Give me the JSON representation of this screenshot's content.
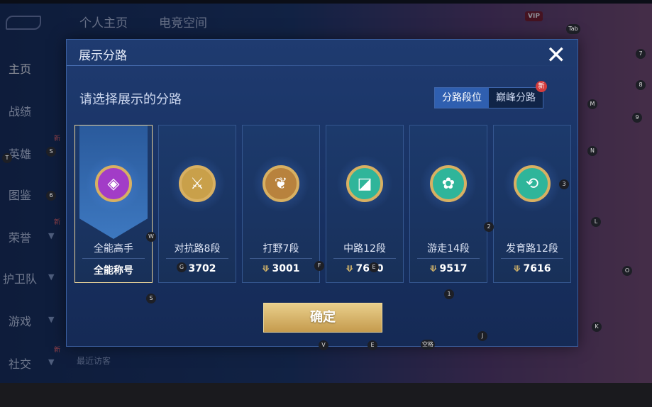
{
  "top_tabs": [
    "个人主页",
    "电竞空间"
  ],
  "left_nav": {
    "items": [
      {
        "label": "主页",
        "new": ""
      },
      {
        "label": "战绩",
        "new": ""
      },
      {
        "label": "英雄",
        "new": "新"
      },
      {
        "label": "图鉴",
        "new": ""
      },
      {
        "label": "荣誉",
        "new": "新"
      },
      {
        "label": "护卫队",
        "new": ""
      },
      {
        "label": "游戏",
        "new": ""
      },
      {
        "label": "社交",
        "new": "新"
      }
    ]
  },
  "top_right": {
    "vip": "VIP"
  },
  "footer": {
    "recent_visitors": "最近访客"
  },
  "dialog": {
    "title": "展示分路",
    "subtitle": "请选择展示的分路",
    "toggle": {
      "options": [
        "分路段位",
        "巅峰分路"
      ],
      "selected": 0,
      "new_badge": "新"
    },
    "cards": [
      {
        "name": "全能高手",
        "value": "全能称号",
        "icon": "versatile-icon",
        "color": "#a23cc7",
        "selected": true
      },
      {
        "name": "对抗路8段",
        "value": "3702",
        "icon": "clash-lane-icon",
        "color": "#c9a04a",
        "selected": false
      },
      {
        "name": "打野7段",
        "value": "3001",
        "icon": "jungle-icon",
        "color": "#b8823d",
        "selected": false
      },
      {
        "name": "中路12段",
        "value": "7680",
        "icon": "mid-lane-icon",
        "color": "#2fb59a",
        "selected": false
      },
      {
        "name": "游走14段",
        "value": "9517",
        "icon": "roam-icon",
        "color": "#2fb59a",
        "selected": false
      },
      {
        "name": "发育路12段",
        "value": "7616",
        "icon": "farm-lane-icon",
        "color": "#2fb59a",
        "selected": false
      }
    ],
    "confirm_label": "确定"
  },
  "keys": [
    "T",
    "S",
    "6",
    "W",
    "S",
    "G",
    "F",
    "E",
    "2",
    "3",
    "1",
    "L",
    "M",
    "N",
    "O",
    "7",
    "8",
    "9",
    "K",
    "J",
    "V",
    "E",
    "空格",
    "Tab"
  ]
}
